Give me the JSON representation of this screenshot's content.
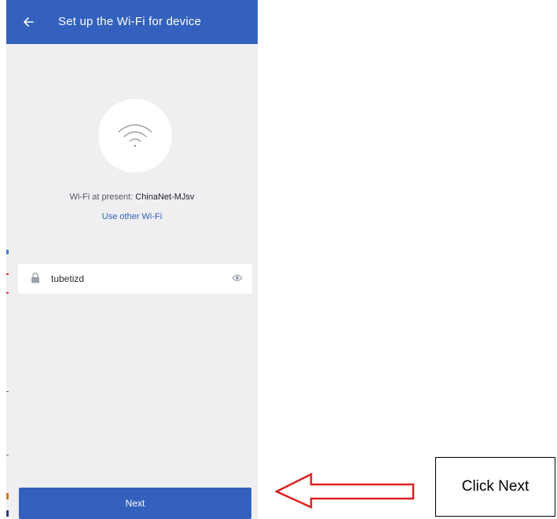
{
  "header": {
    "title": "Set up the Wi-Fi for device",
    "back_icon": "arrow-left-icon"
  },
  "wifi": {
    "icon": "wifi-icon",
    "present_label": "Wi-Fi at present:",
    "present_ssid": "ChinaNet-MJsv",
    "other_link": "Use other Wi-Fi"
  },
  "password": {
    "value": "tubetizd",
    "lock_icon": "lock-icon",
    "toggle_icon": "eye-icon"
  },
  "next_label": "Next",
  "annotation": {
    "callout_text": "Click Next",
    "arrow_color": "#e02020"
  },
  "colors": {
    "brand_blue": "#3361bd",
    "page_background": "#efeff1"
  }
}
